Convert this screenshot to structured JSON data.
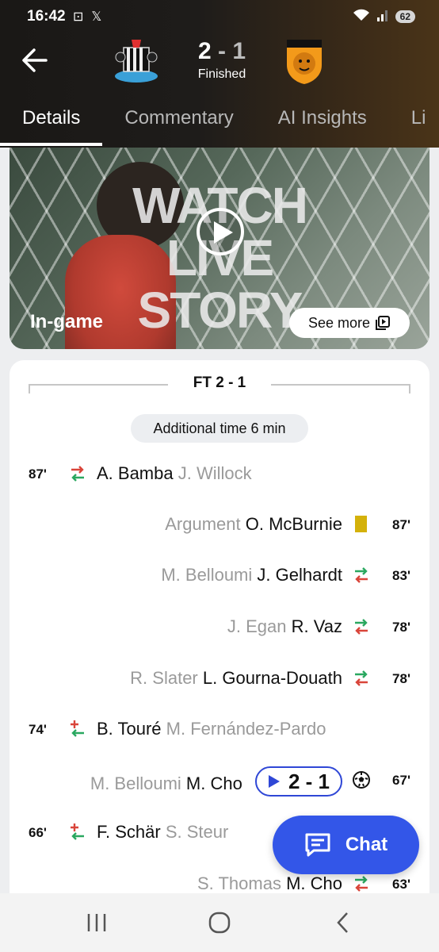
{
  "status_bar": {
    "time": "16:42",
    "battery": "62"
  },
  "match": {
    "home_score": "2",
    "separator": "-",
    "away_score": "1",
    "status": "Finished"
  },
  "tabs": [
    {
      "label": "Details",
      "active": true
    },
    {
      "label": "Commentary",
      "active": false
    },
    {
      "label": "AI Insights",
      "active": false
    },
    {
      "label": "Li",
      "active": false
    }
  ],
  "story": {
    "headline_line1": "WATCH",
    "headline_line2": "LIVE STORY",
    "tag": "In-game",
    "see_more": "See more"
  },
  "timeline": {
    "ft_label": "FT 2 - 1",
    "additional_time": "Additional time 6 min",
    "events": [
      {
        "side": "left",
        "minute": "87'",
        "type": "substitution",
        "primary": "A. Bamba",
        "secondary": "J. Willock"
      },
      {
        "side": "right",
        "minute": "87'",
        "type": "yellow-card",
        "primary": "O. McBurnie",
        "secondary": "Argument"
      },
      {
        "side": "right",
        "minute": "83'",
        "type": "substitution",
        "primary": "J. Gelhardt",
        "secondary": "M. Belloumi"
      },
      {
        "side": "right",
        "minute": "78'",
        "type": "substitution",
        "primary": "R. Vaz",
        "secondary": "J. Egan"
      },
      {
        "side": "right",
        "minute": "78'",
        "type": "substitution",
        "primary": "L. Gourna-Douath",
        "secondary": "R. Slater"
      },
      {
        "side": "left",
        "minute": "74'",
        "type": "injury-substitution",
        "primary": "B. Touré",
        "secondary": "M. Fernández-Pardo"
      },
      {
        "side": "right",
        "minute": "67'",
        "type": "goal",
        "primary": "M. Cho",
        "secondary": "M. Belloumi",
        "score": "2 - 1"
      },
      {
        "side": "left",
        "minute": "66'",
        "type": "injury-substitution",
        "primary": "F. Schär",
        "secondary": "S. Steur"
      },
      {
        "side": "right",
        "minute": "63'",
        "type": "substitution",
        "primary": "M. Cho",
        "secondary": "S. Thomas"
      }
    ]
  },
  "chat_button": {
    "label": "Chat"
  },
  "colors": {
    "accent": "#3356e8",
    "sub_in": "#2aa860",
    "sub_out": "#d9453a",
    "yellow_card": "#d4b10a"
  }
}
